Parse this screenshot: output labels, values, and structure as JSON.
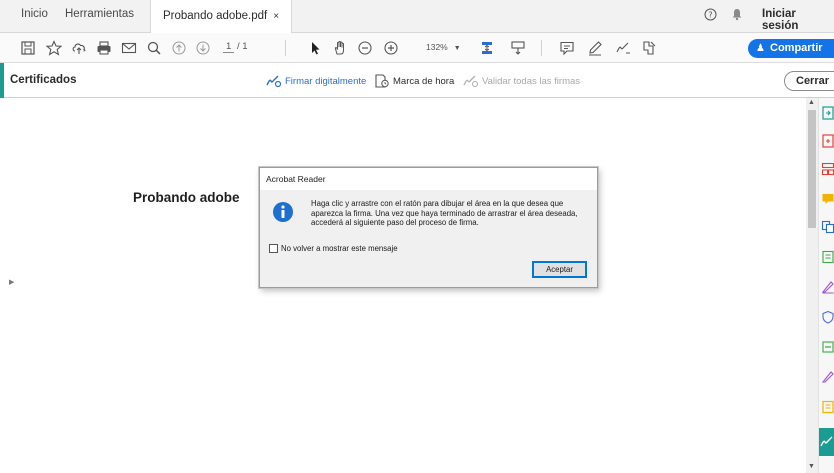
{
  "tabs": [
    {
      "label": "Inicio"
    },
    {
      "label": "Herramientas"
    },
    {
      "label": "Probando adobe.pdf",
      "close": "×"
    }
  ],
  "header_right": {
    "help_icon": "help-circle-icon",
    "bell_icon": "bell-icon",
    "signin_label": "Iniciar sesión"
  },
  "toolbar": {
    "icons": [
      "save-icon",
      "bookmark-star-icon",
      "upload-cloud-icon",
      "print-icon",
      "email-icon",
      "search-icon",
      "page-up-icon",
      "page-down-icon",
      "select-cursor-icon",
      "hand-icon",
      "zoom-out-icon",
      "zoom-in-icon",
      "fit-page-icon",
      "scroll-mode-icon",
      "comment-icon",
      "highlight-pen-icon",
      "sign-icon",
      "more-tools-icon"
    ],
    "page_current": "1",
    "page_total": "/ 1",
    "zoom": "132%",
    "share_label": "Compartir"
  },
  "certificates_bar": {
    "title": "Certificados",
    "digital_sign": "Firmar digitalmente",
    "timestamp": "Marca de hora",
    "validate_all": "Validar todas las firmas",
    "close_label": "Cerrar"
  },
  "document": {
    "text": "Probando adobe"
  },
  "dialog": {
    "title": "Acrobat Reader",
    "message": "Haga clic y arrastre con el ratón para dibujar el área en la que desea que aparezca la firma. Una vez que haya terminado de arrastrar el área deseada, accederá al siguiente paso del proceso de firma.",
    "checkbox_label": "No volver a mostrar este mensaje",
    "checkbox_checked": false,
    "ok_label": "Aceptar"
  },
  "colors": {
    "accent_teal": "#1c9b92",
    "share_blue": "#1473e6",
    "link_blue": "#2b6fce"
  }
}
